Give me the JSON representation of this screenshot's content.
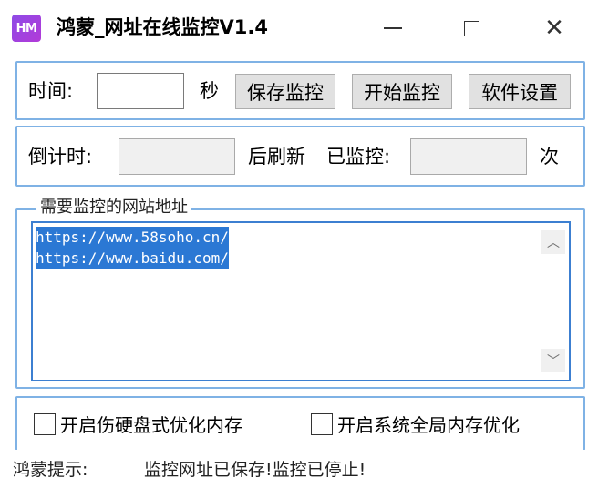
{
  "window": {
    "app_icon_text": "HM",
    "title": "鸿蒙_网址在线监控V1.4",
    "minimize_glyph": "",
    "maximize_glyph": "",
    "close_glyph": "✕"
  },
  "timer_row": {
    "time_label": "时间:",
    "time_value": "",
    "seconds_label": "秒",
    "save_button": "保存监控",
    "start_button": "开始监控",
    "settings_button": "软件设置"
  },
  "countdown_row": {
    "countdown_label": "倒计时:",
    "countdown_value": "",
    "refresh_label": "后刷新",
    "monitored_label": "已监控:",
    "monitored_value": "",
    "times_label": "次"
  },
  "url_group": {
    "legend": "需要监控的网站地址",
    "urls": [
      "https://www.58soho.cn/",
      "https://www.baidu.com/"
    ],
    "scroll_up_glyph": "︿",
    "scroll_down_glyph": "﹀"
  },
  "options": {
    "hdd_cache": {
      "label": "开启伤硬盘式优化内存",
      "checked": false
    },
    "global_memory": {
      "label": "开启系统全局内存优化",
      "checked": false
    }
  },
  "status_bar": {
    "prefix": "鸿蒙提示:",
    "message": "监控网址已保存!监控已停止!"
  }
}
